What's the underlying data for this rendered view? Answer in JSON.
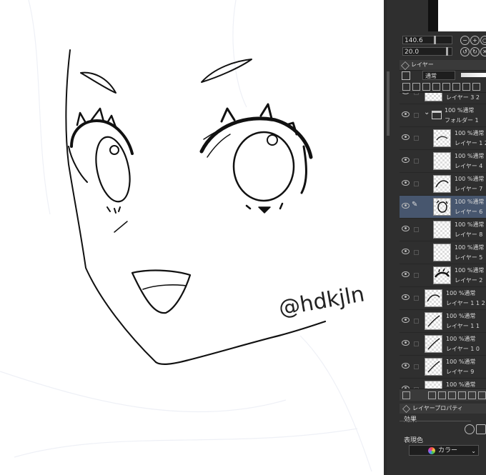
{
  "canvas": {
    "signature": "@hdkjln"
  },
  "panel": {
    "brush_size": "140.6",
    "brush_opacity": "20.0",
    "layer_tab_label": "レイヤー",
    "blend_mode": "通常",
    "layers": [
      {
        "line1": "レイヤー 3 2",
        "line2": "",
        "type": "partial"
      },
      {
        "line1": "100 %通常",
        "line2": "フォルダー 1",
        "type": "folder"
      },
      {
        "line1": "100 %通常",
        "line2": "レイヤー 1 2",
        "type": "child",
        "thumb": "text"
      },
      {
        "line1": "100 %通常",
        "line2": "レイヤー 4",
        "type": "child",
        "thumb": "blank"
      },
      {
        "line1": "100 %通常",
        "line2": "レイヤー 7",
        "type": "child",
        "thumb": "arc"
      },
      {
        "line1": "100 %通常",
        "line2": "レイヤー 6",
        "type": "child",
        "thumb": "eye",
        "selected": true
      },
      {
        "line1": "100 %通常",
        "line2": "レイヤー 8",
        "type": "child",
        "thumb": "blank"
      },
      {
        "line1": "100 %通常",
        "line2": "レイヤー 5",
        "type": "child",
        "thumb": "blank"
      },
      {
        "line1": "100 %通常",
        "line2": "レイヤー 2",
        "type": "child",
        "thumb": "lash"
      },
      {
        "line1": "100 %通常",
        "line2": "レイヤー 1 1 2",
        "type": "top",
        "thumb": "arc"
      },
      {
        "line1": "100 %通常",
        "line2": "レイヤー 1 1",
        "type": "top",
        "thumb": "line"
      },
      {
        "line1": "100 %通常",
        "line2": "レイヤー 1 0",
        "type": "top",
        "thumb": "line"
      },
      {
        "line1": "100 %通常",
        "line2": "レイヤー 9",
        "type": "top",
        "thumb": "line"
      },
      {
        "line1": "100 %通常",
        "line2": "",
        "type": "top",
        "thumb": "blank"
      }
    ],
    "property_tab_label": "レイヤープロパティ",
    "effect_label": "効果",
    "expression_color_label": "表現色",
    "expression_color_value": "カラー"
  }
}
